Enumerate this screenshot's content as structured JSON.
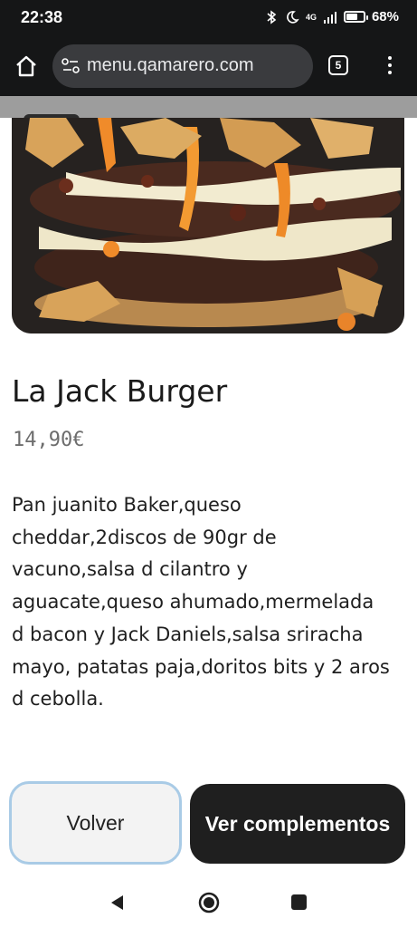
{
  "status_bar": {
    "time": "22:38",
    "network": "4G",
    "battery": "68%",
    "battery_level": 0.68,
    "icons": [
      "bluetooth-icon",
      "moon-icon",
      "signal-icon",
      "battery-icon"
    ]
  },
  "browser": {
    "url": "menu.qamarero.com",
    "tab_count": "5",
    "icons": [
      "home-icon",
      "site-settings-icon",
      "tabs-icon",
      "more-menu-icon"
    ]
  },
  "product": {
    "title": "La Jack Burger",
    "price": "14,90€",
    "description": "Pan juanito Baker,queso cheddar,2discos de 90gr de vacuno,salsa d cilantro y aguacate,queso ahumado,mermelada d bacon y Jack Daniels,salsa sriracha mayo, patatas paja,doritos bits y 2 aros d cebolla."
  },
  "actions": {
    "back_label": "Volver",
    "extras_label": "Ver complementos"
  },
  "nav": {
    "icons": [
      "nav-back-icon",
      "nav-home-icon",
      "nav-recents-icon"
    ]
  },
  "colors": {
    "system_bar": "#151617",
    "url_box": "#3a3b3e",
    "primary_button": "#1f1f1f",
    "secondary_button": "#f3f3f3",
    "focus_border": "#a9cbe6"
  }
}
